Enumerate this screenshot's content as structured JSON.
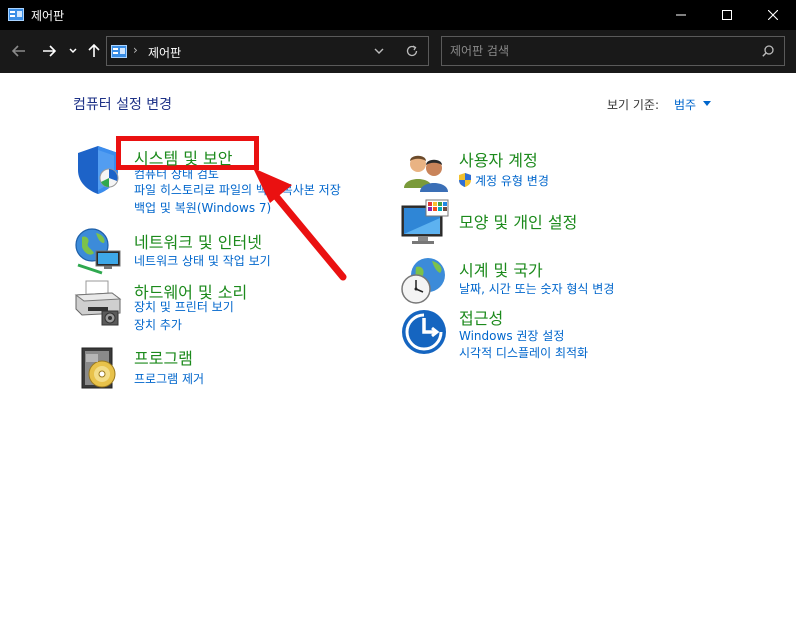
{
  "window": {
    "title": "제어판"
  },
  "address": {
    "crumb": "제어판",
    "separator": "›"
  },
  "search": {
    "placeholder": "제어판 검색"
  },
  "main": {
    "title": "컴퓨터 설정 변경",
    "view_by_label": "보기 기준:",
    "view_by_value": "범주"
  },
  "categories": [
    {
      "title": "시스템 및 보안",
      "links": [
        "컴퓨터 상태 검토",
        "파일 히스토리로 파일의 백업 복사본 저장",
        "백업 및 복원(Windows 7)"
      ]
    },
    {
      "title": "네트워크 및 인터넷",
      "links": [
        "네트워크 상태 및 작업 보기"
      ]
    },
    {
      "title": "하드웨어 및 소리",
      "links": [
        "장치 및 프린터 보기",
        "장치 추가"
      ]
    },
    {
      "title": "프로그램",
      "links": [
        "프로그램 제거"
      ]
    },
    {
      "title": "사용자 계정",
      "links": [
        "계정 유형 변경"
      ]
    },
    {
      "title": "모양 및 개인 설정",
      "links": []
    },
    {
      "title": "시계 및 국가",
      "links": [
        "날짜, 시간 또는 숫자 형식 변경"
      ]
    },
    {
      "title": "접근성",
      "links": [
        "Windows 권장 설정",
        "시각적 디스플레이 최적화"
      ]
    }
  ],
  "colors": {
    "category_title": "#1c8a1c",
    "link": "#0066cc",
    "highlight": "#ea1111",
    "titlebar": "#000000",
    "navbar": "#191919"
  },
  "icons": {
    "system_security": "shield-icon",
    "network": "globe-network-icon",
    "hardware": "printer-icon",
    "programs": "programs-disc-icon",
    "user_accounts": "users-icon",
    "appearance": "monitor-palette-icon",
    "clock_region": "clock-globe-icon",
    "accessibility": "ease-of-access-icon"
  }
}
